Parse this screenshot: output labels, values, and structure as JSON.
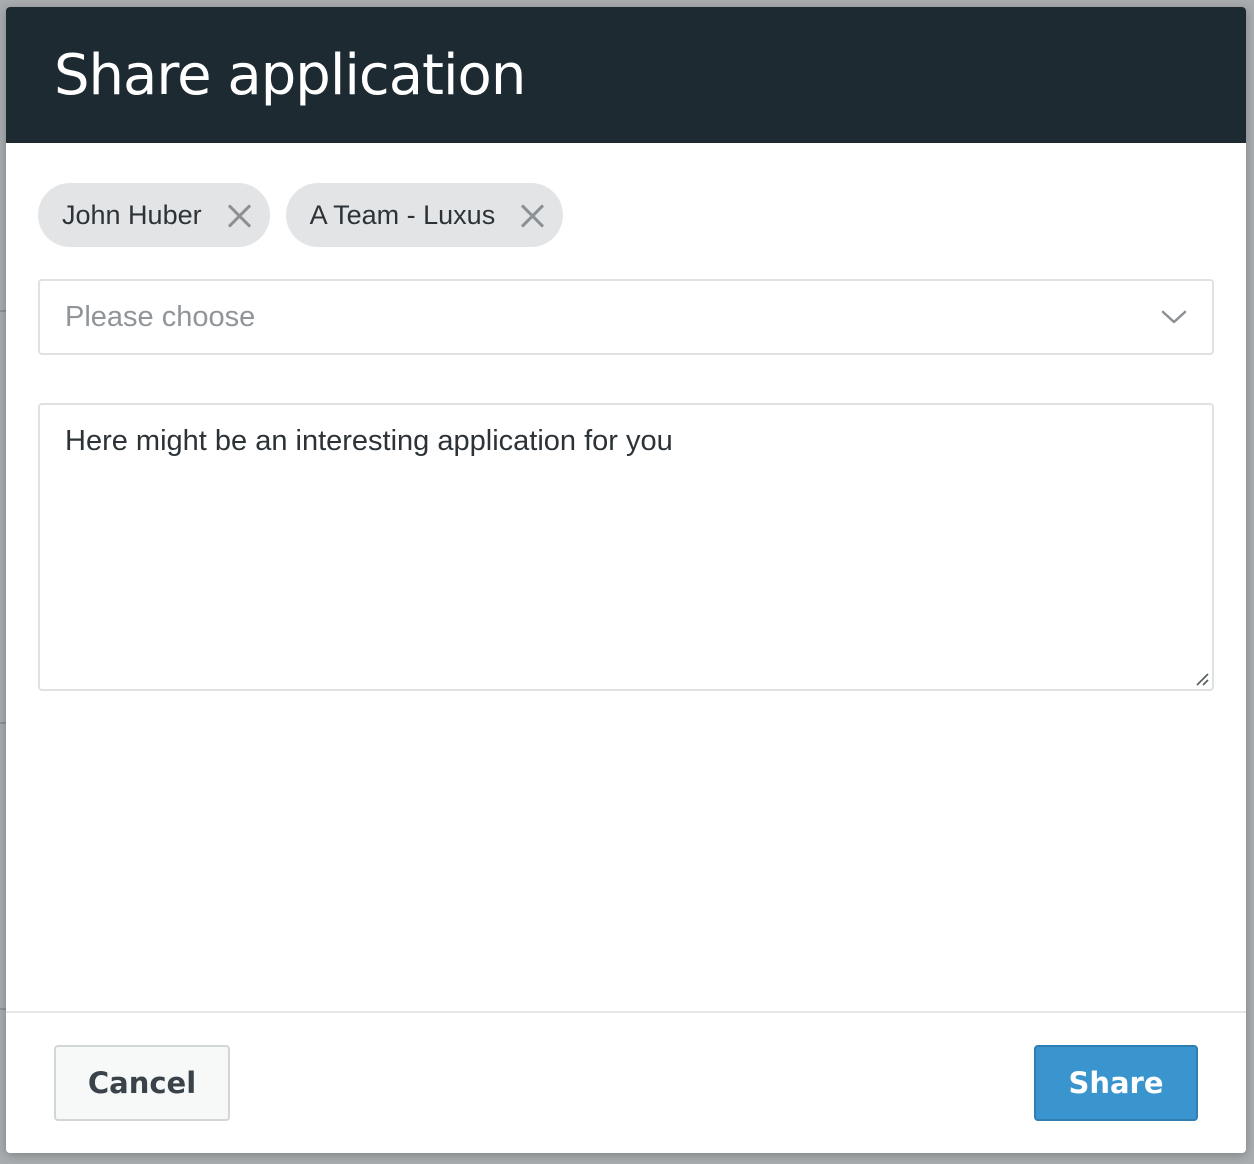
{
  "modal": {
    "title": "Share application"
  },
  "recipients": [
    {
      "label": "John Huber"
    },
    {
      "label": "A Team - Luxus"
    }
  ],
  "recipient_select": {
    "placeholder": "Please choose"
  },
  "message": {
    "value": "Here might be an interesting application for you"
  },
  "footer": {
    "cancel_label": "Cancel",
    "share_label": "Share"
  },
  "colors": {
    "header_bg": "#1e2a32",
    "chip_bg": "#e3e4e5",
    "primary": "#3a94cd"
  },
  "icons": {
    "chip_remove": "close-icon",
    "select_toggle": "chevron-down-icon",
    "textarea_resize": "resize-handle-icon"
  }
}
